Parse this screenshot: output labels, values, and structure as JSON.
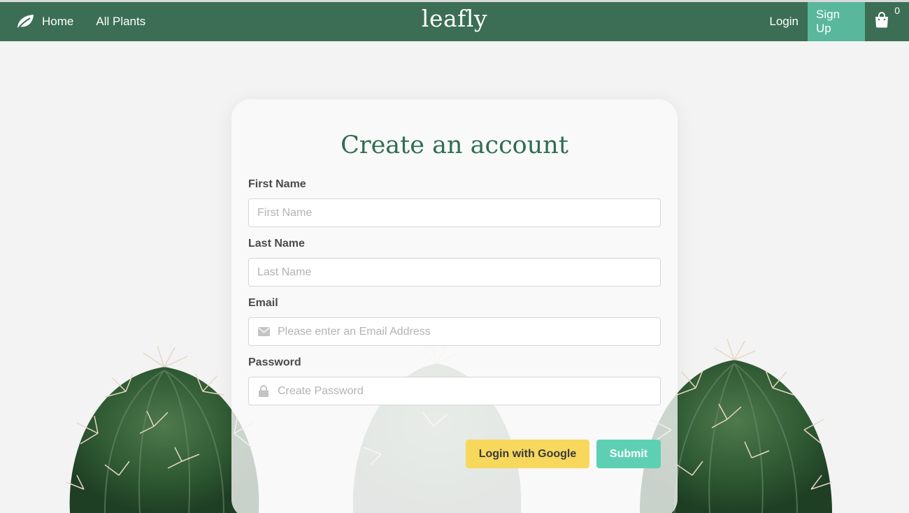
{
  "nav": {
    "home": "Home",
    "all_plants": "All Plants",
    "brand": "leafly",
    "login": "Login",
    "signup": "Sign Up",
    "cart_count": "0"
  },
  "form": {
    "title": "Create an account",
    "first_name_label": "First Name",
    "first_name_placeholder": "First Name",
    "last_name_label": "Last Name",
    "last_name_placeholder": "Last Name",
    "email_label": "Email",
    "email_placeholder": "Please enter an Email Address",
    "password_label": "Password",
    "password_placeholder": "Create Password",
    "google_button": "Login with Google",
    "submit_button": "Submit"
  },
  "colors": {
    "navbar": "#3b6e55",
    "signup_highlight": "#59b79b",
    "title": "#2e6d51",
    "google_button": "#f7d85c",
    "submit_button": "#5dd0b4"
  },
  "icons": {
    "brand_logo": "leaf-icon",
    "cart": "shopping-bag-icon",
    "email_field": "envelope-icon",
    "password_field": "lock-icon"
  }
}
